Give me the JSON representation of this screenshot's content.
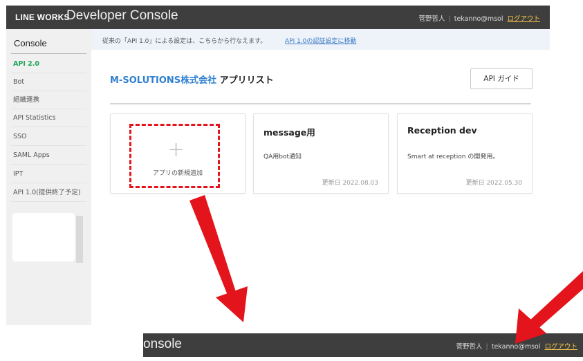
{
  "header": {
    "logo": "LINE WORKS",
    "product": "Developer Console",
    "user_name": "菅野哲人",
    "user_email": "tekanno@msol",
    "logout_label": "ログアウト"
  },
  "sidebar": {
    "title": "Console",
    "items": [
      {
        "label": "API 2.0"
      },
      {
        "label": "Bot"
      },
      {
        "label": "組織連携"
      },
      {
        "label": "API Statistics"
      },
      {
        "label": "SSO"
      },
      {
        "label": "SAML Apps"
      },
      {
        "label": "IPT"
      },
      {
        "label": "API 1.0(提供終了予定)"
      }
    ]
  },
  "notice": {
    "text": "従来の「API 1.0」による設定は、こちらから行なえます。",
    "link": "API 1.0の認証設定に移動"
  },
  "main": {
    "company": "M-SOLUTIONS株式会社",
    "title": "アプリリスト",
    "guide_button": "API ガイド"
  },
  "cards": [
    {
      "type": "add",
      "label": "アプリの新規追加"
    },
    {
      "title": "message用",
      "desc": "QA用bot通知",
      "date": "更新日 2022.08.03"
    },
    {
      "title": "Reception dev",
      "desc": "Smart at reception の開発用。",
      "date": "更新日 2022.05.30"
    }
  ],
  "bottom_header": {
    "product_fragment": "onsole",
    "user_name": "菅野哲人",
    "user_email": "tekanno@msol",
    "logout_label": "ログアウト"
  },
  "colors": {
    "header_bg": "#3e3e3e",
    "accent_green": "#1ea45a",
    "company_blue": "#2f7fd0",
    "annotation_red": "#e4141c"
  }
}
